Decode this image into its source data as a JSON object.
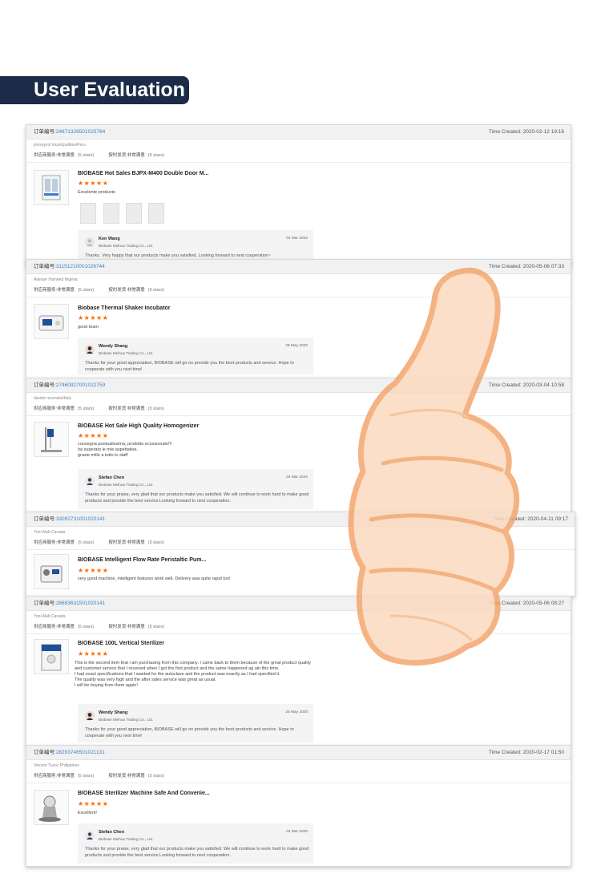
{
  "header": {
    "title": "User Evaluation"
  },
  "labels": {
    "order_no": "订单编号:",
    "time_created": "Time Created:",
    "supplier_service": "供应商服务:",
    "on_time_shipping": "按时发货:",
    "very_satisfied": "非常满意",
    "five_stars": "(5 stars)"
  },
  "stars": "★★★★★",
  "colors": {
    "banner": "#1b2b48",
    "star": "#ff6a00",
    "order_link": "#3d7fc9",
    "thumb": "#f7b78a"
  },
  "reviews": [
    {
      "order_no": "2467132650102578​4",
      "time": "2020-02-12 19:16",
      "buyer": "jimmyprol municipalities/Peru",
      "product": "BIOBASE Hot Sales BJPX-M400 Double Door M...",
      "comment": "Excelente producto",
      "reply": {
        "name": "Ken Wang",
        "company": "Biobase Meihua Trading Co., Ltd.",
        "date": "04 Mar 2020",
        "text": "Thanks. Very happy that our products make you satisfied. Looking forward to next cooperation~"
      }
    },
    {
      "order_no": "3115121000102674​4",
      "time": "2020-05-06 07:33",
      "buyer": "Adeoye Hameed Nigeria",
      "product": "Biobase Thermal Shaker Incubator",
      "comment": "good team",
      "reply": {
        "name": "Wendy Shang",
        "company": "Biobase Meihua Trading Co., Ltd.",
        "date": "28 May 2020",
        "text": "Thanks for your good appreciation, BIOBASE will go on provide you the best products and service. Hope to cooperate with you next time!"
      }
    },
    {
      "order_no": "2746092700102275​9",
      "time": "2020-03-04 10:58",
      "buyer": "davide recensito/Italy",
      "product": "BIOBASE Hot Sale High Quality Homogenizer",
      "comment": "consegna puntualissima, prodotto eccezionale!!!\nha superato le mie aspettative.\ngrazie mille a tutto lo staff",
      "reply": {
        "name": "Stefan Chen",
        "company": "Biobase Meihua Trading Co., Ltd.",
        "date": "04 Mar 2020",
        "text": "Thanks for your praise, very glad that our products make you satisfied. We will continue to work hard to make good products and provide the best service.Looking forward to next cooperation."
      }
    },
    {
      "order_no": "3309273100102014​1",
      "time": "2020-04-11 09:17",
      "buyer": "Yoni Alab Canada",
      "product": "BIOBASE Intelligent Flow Rate Peristaltic Pum...",
      "comment": "very good machine, intelligent features work well. Delivery was quite rapid too!"
    },
    {
      "order_no": "2869363150102014​1",
      "time": "2020-05-06 08:27",
      "buyer": "Yoni Alab Canada",
      "product": "BIOBASE 100L Vertical Sterilizer",
      "comment": "This is the second item that i am purchasing from this company. I came back to them because of the great product quality and customer service that I received when I got the first product and the same happened ag ain this time.\nI had exact specifications that I wanted for the autoclave and the product was exactly as I had specified it.\nThe quality was very high and the after sales service was great as usual.\nI will be buying from them again!",
      "reply": {
        "name": "Wendy Shang",
        "company": "Biobase Meihua Trading Co., Ltd.",
        "date": "26 May 2020",
        "text": "Thanks for your good appreciation, BIOBASE will go on provide you the best products and service. Hope to cooperate with you next time!"
      }
    },
    {
      "order_no": "2829374650102113​1",
      "time": "2020-02-17 01:50",
      "buyer": "Vincent Tusoc Philippines",
      "product": "BIOBASE Sterilizer Machine Safe And Convenie...",
      "comment": "Excellent!",
      "reply": {
        "name": "Stefan Chen",
        "company": "Biobase Meihua Trading Co., Ltd.",
        "date": "04 Mar 2020",
        "text": "Thanks for your praise, very glad that our products make you satisfied. We will continue to work hard to make good products and provide the best service.Looking forward to next cooperation."
      }
    }
  ]
}
